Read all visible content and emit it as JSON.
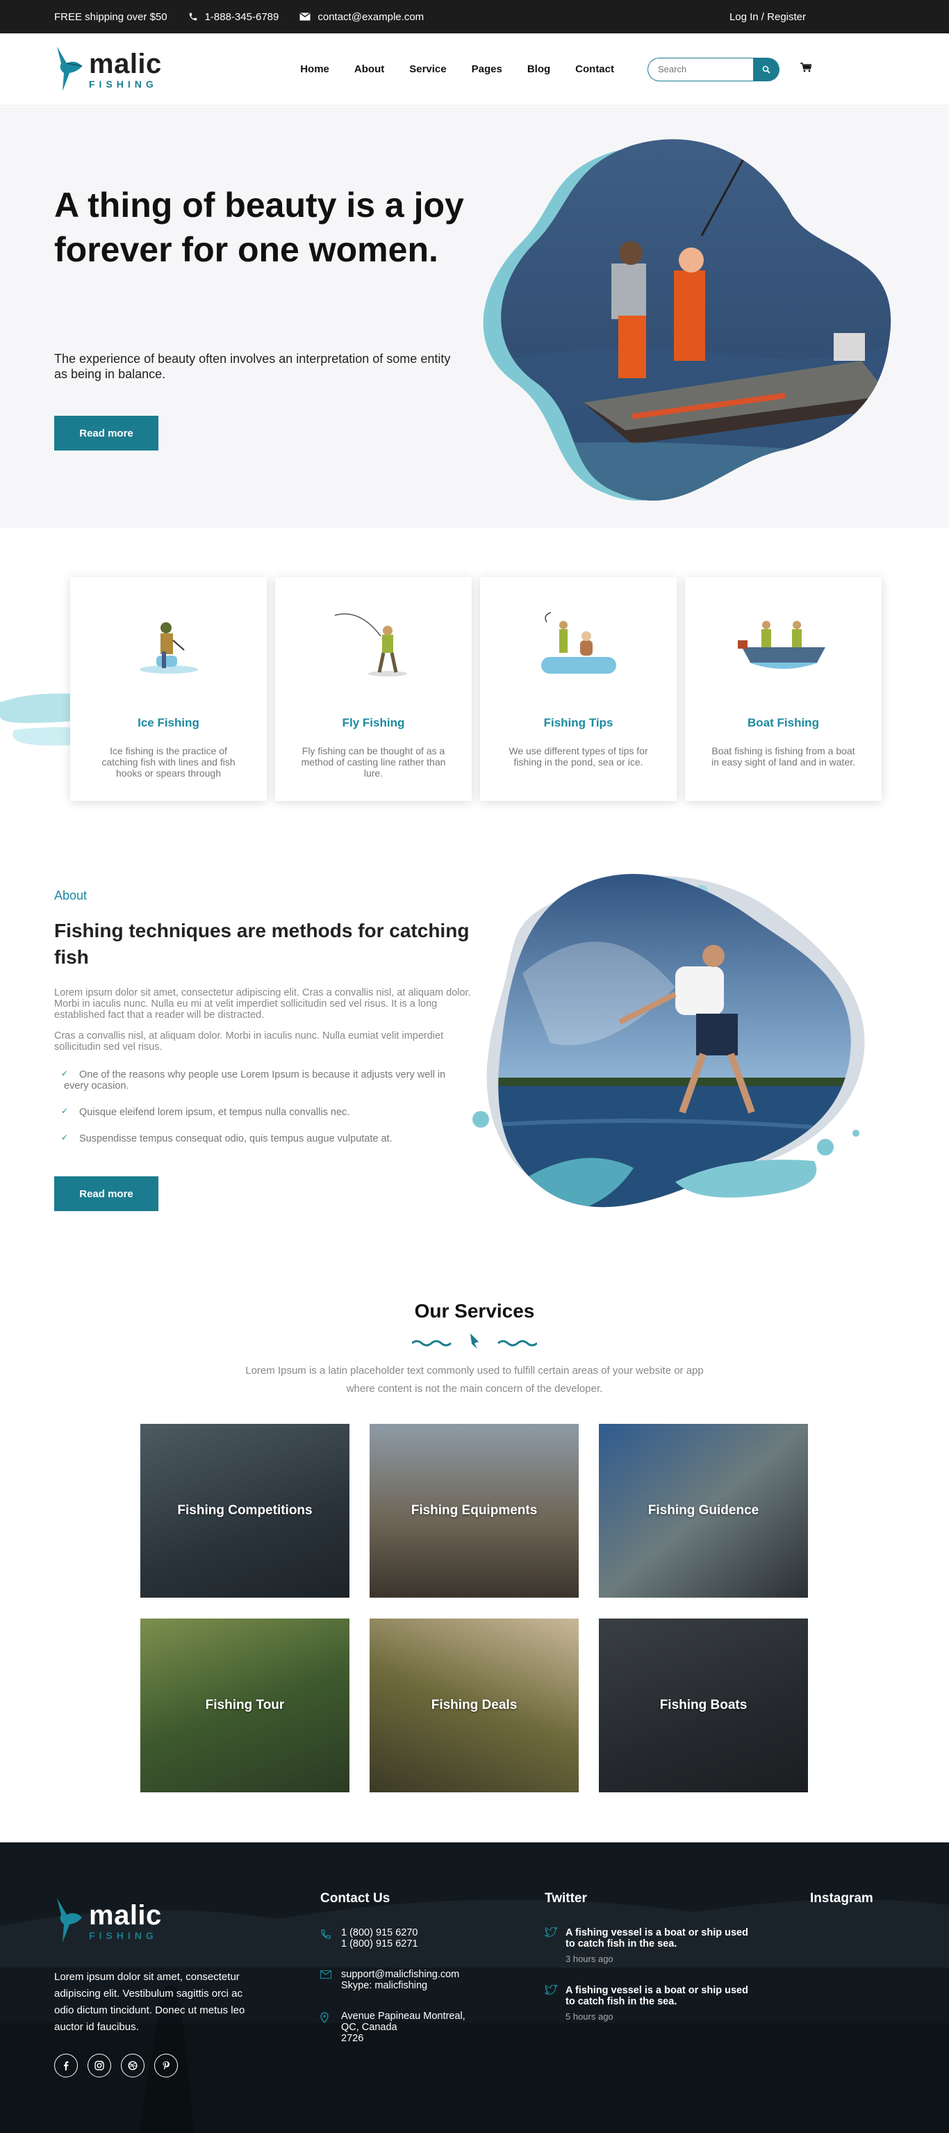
{
  "topbar": {
    "shipping": "FREE shipping over $50",
    "phone": "1-888-345-6789",
    "email": "contact@example.com",
    "login": "Log In / Register"
  },
  "header": {
    "logo_main": "malic",
    "logo_sub": "FISHING",
    "nav": [
      "Home",
      "About",
      "Service",
      "Pages",
      "Blog",
      "Contact"
    ],
    "search_placeholder": "Search"
  },
  "hero": {
    "title": "A thing of beauty is a joy forever for one women.",
    "text": "The experience of beauty often involves an interpretation of some entity as being in balance.",
    "button": "Read more"
  },
  "categories": [
    {
      "title": "Ice Fishing",
      "text": "Ice fishing is the practice of catching fish with lines and fish hooks or spears through"
    },
    {
      "title": "Fly Fishing",
      "text": "Fly fishing can be thought of as a method of casting line rather than lure."
    },
    {
      "title": "Fishing Tips",
      "text": "We use different types of tips for fishing in the pond, sea or ice."
    },
    {
      "title": "Boat Fishing",
      "text": "Boat fishing is fishing from a boat in easy sight of land and in water."
    }
  ],
  "about": {
    "tag": "About",
    "title": "Fishing techniques are methods for catching fish",
    "p1": "Lorem ipsum dolor sit amet, consectetur adipiscing elit. Cras a convallis nisl, at aliquam dolor. Morbi in iaculis nunc. Nulla eu mi at velit imperdiet sollicitudin sed vel risus. It is a long established fact that a reader will be distracted.",
    "p2": "Cras a convallis nisl, at aliquam dolor. Morbi in iaculis nunc. Nulla eumiat velit imperdiet sollicitudin sed vel risus.",
    "list": [
      "One of the reasons why people use Lorem Ipsum is because it adjusts very well in every ocasion.",
      "Quisque eleifend lorem ipsum, et tempus nulla convallis nec.",
      "Suspendisse tempus consequat odio, quis tempus augue vulputate at."
    ],
    "button": "Read more"
  },
  "services": {
    "title": "Our Services",
    "text": "Lorem Ipsum is a latin placeholder text commonly used to fulfill certain areas of your website or app where content is not the main concern of the developer.",
    "items": [
      "Fishing Competitions",
      "Fishing Equipments",
      "Fishing Guidence",
      "Fishing Tour",
      "Fishing Deals",
      "Fishing Boats"
    ]
  },
  "footer": {
    "logo_main": "malic",
    "logo_sub": "FISHING",
    "about": "Lorem ipsum dolor sit amet, consectetur adipiscing elit. Vestibulum sagittis orci ac odio dictum tincidunt. Donec ut metus leo auctor id faucibus.",
    "contact_title": "Contact Us",
    "phone1": "1 (800) 915 6270",
    "phone2": "1 (800) 915 6271",
    "email": "support@malicfishing.com",
    "skype": "Skype: malicfishing",
    "addr1": "Avenue Papineau Montreal,",
    "addr2": "QC, Canada",
    "addr3": "2726",
    "twitter_title": "Twitter",
    "tweets": [
      {
        "text": "A fishing vessel is a boat or ship used to catch fish in the sea.",
        "time": "3 hours ago"
      },
      {
        "text": "A fishing vessel is a boat or ship used to catch fish in the sea.",
        "time": "5 hours ago"
      }
    ],
    "instagram_title": "Instagram"
  },
  "colors": {
    "accent": "#1b7c8f",
    "dark": "#1c1c1c",
    "hero_bg": "#f6f6f8"
  }
}
